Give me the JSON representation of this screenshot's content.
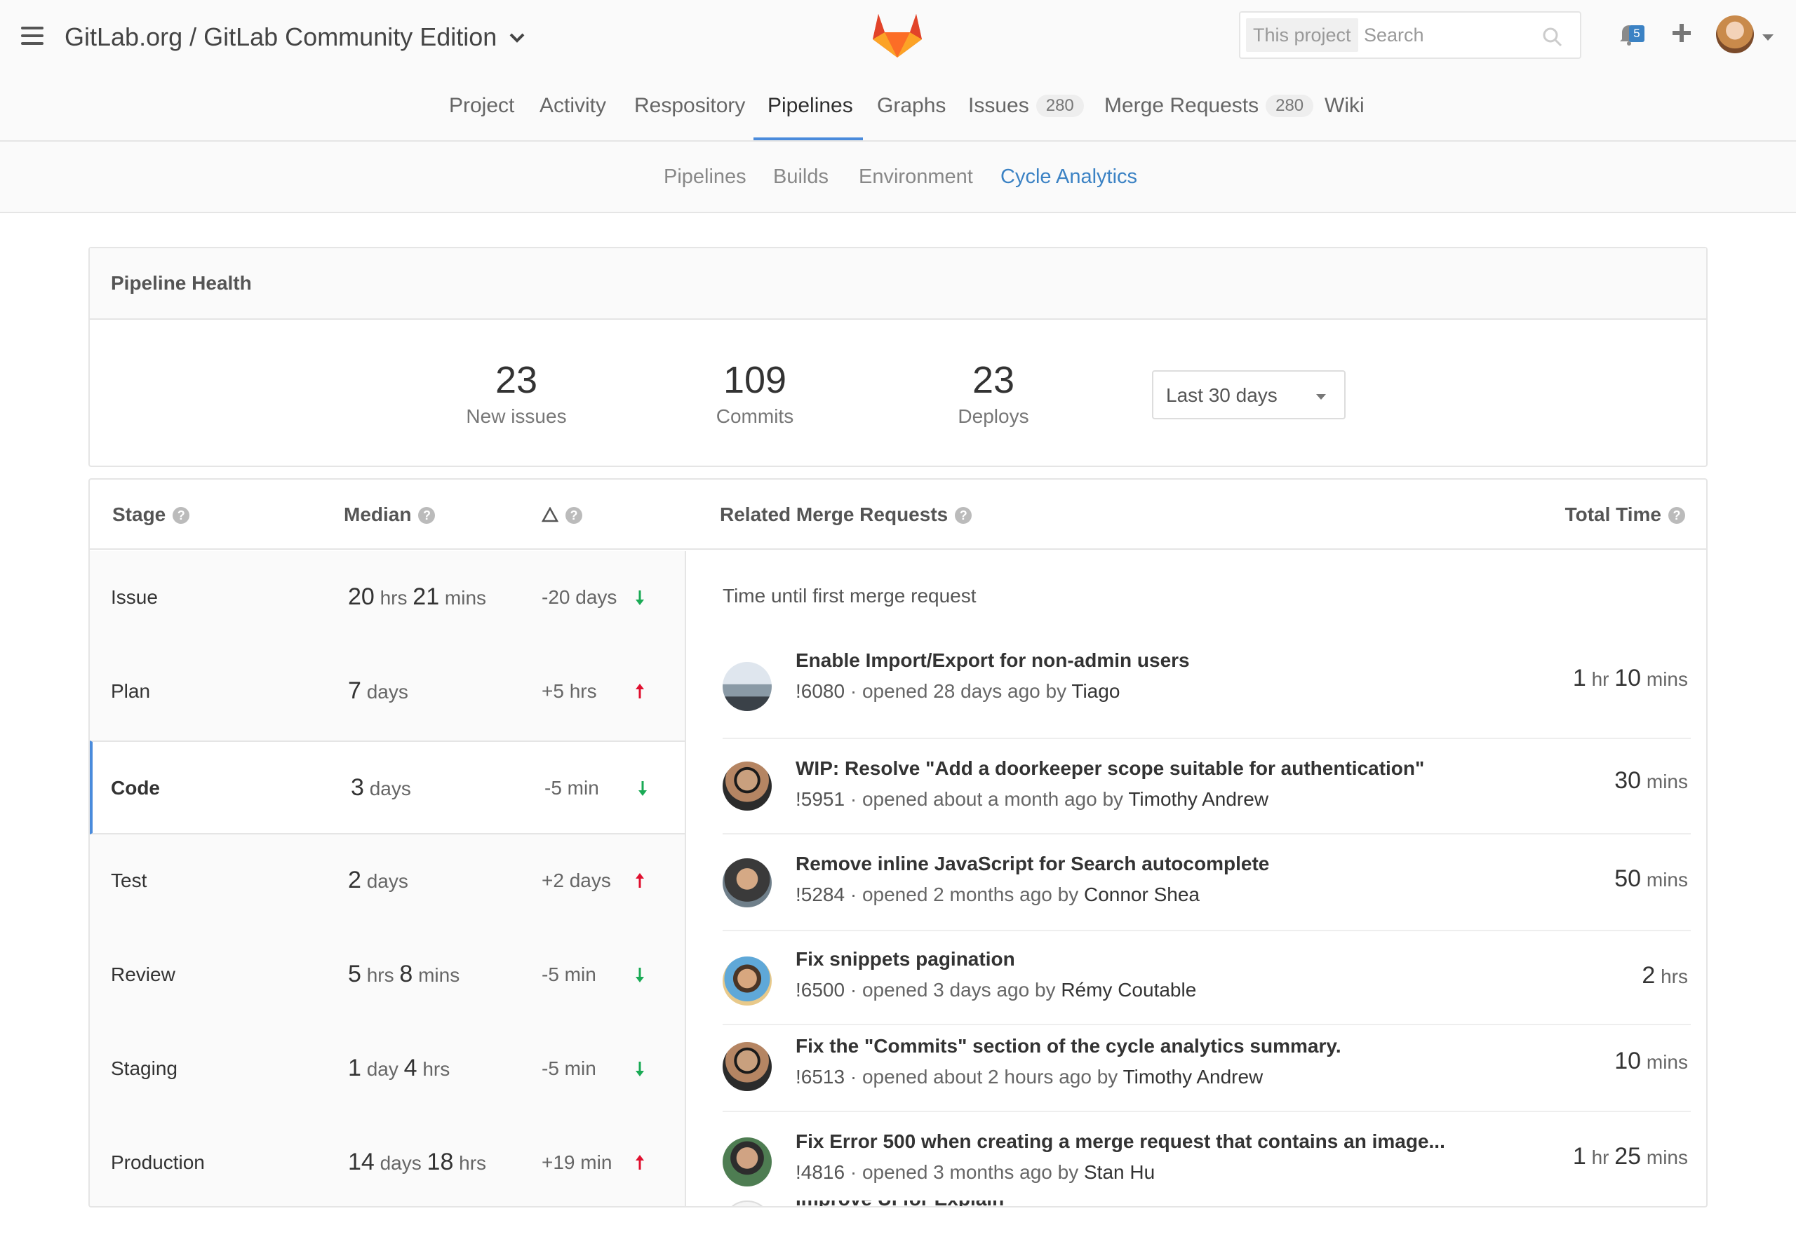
{
  "header": {
    "project_title": "GitLab.org / GitLab Community Edition",
    "search_scope": "This project",
    "search_placeholder": "Search",
    "notification_count": "5"
  },
  "nav": {
    "tabs": [
      {
        "label": "Project"
      },
      {
        "label": "Activity"
      },
      {
        "label": "Respository"
      },
      {
        "label": "Pipelines",
        "active": true
      },
      {
        "label": "Graphs"
      },
      {
        "label": "Issues",
        "badge": "280"
      },
      {
        "label": "Merge Requests",
        "badge": "280"
      },
      {
        "label": "Wiki"
      }
    ]
  },
  "subnav": {
    "tabs": [
      {
        "label": "Pipelines"
      },
      {
        "label": "Builds"
      },
      {
        "label": "Environment"
      },
      {
        "label": "Cycle Analytics",
        "active": true
      }
    ]
  },
  "health": {
    "title": "Pipeline Health",
    "stats": [
      {
        "value": "23",
        "label": "New issues"
      },
      {
        "value": "109",
        "label": "Commits"
      },
      {
        "value": "23",
        "label": "Deploys"
      }
    ],
    "period": "Last 30 days"
  },
  "table": {
    "headers": {
      "stage": "Stage",
      "median": "Median",
      "related": "Related Merge Requests",
      "total": "Total Time"
    },
    "stages": [
      {
        "name": "Issue",
        "median": [
          [
            "20",
            "hrs"
          ],
          [
            "21",
            "mins"
          ]
        ],
        "delta": "-20 days",
        "trend": "down"
      },
      {
        "name": "Plan",
        "median": [
          [
            "7",
            "days"
          ]
        ],
        "delta": "+5 hrs",
        "trend": "up"
      },
      {
        "name": "Code",
        "median": [
          [
            "3",
            "days"
          ]
        ],
        "delta": "-5 min",
        "trend": "down",
        "active": true
      },
      {
        "name": "Test",
        "median": [
          [
            "2",
            "days"
          ]
        ],
        "delta": "+2 days",
        "trend": "up"
      },
      {
        "name": "Review",
        "median": [
          [
            "5",
            "hrs"
          ],
          [
            "8",
            "mins"
          ]
        ],
        "delta": "-5 min",
        "trend": "down"
      },
      {
        "name": "Staging",
        "median": [
          [
            "1",
            "day"
          ],
          [
            "4",
            "hrs"
          ]
        ],
        "delta": "-5 min",
        "trend": "down"
      },
      {
        "name": "Production",
        "median": [
          [
            "14",
            "days"
          ],
          [
            "18",
            "hrs"
          ]
        ],
        "delta": "+19 min",
        "trend": "up"
      }
    ],
    "caption": "Time until first merge request",
    "merge_requests": [
      {
        "title": "Enable Import/Export for non-admin users",
        "id": "!6080",
        "opened": "opened 28 days ago by",
        "author": "Tiago",
        "time": [
          [
            "1",
            "hr"
          ],
          [
            "10",
            "mins"
          ]
        ],
        "avatar": "landscape"
      },
      {
        "title": "WIP: Resolve \"Add a doorkeeper scope suitable for authentication\"",
        "id": "!5951",
        "opened": "opened about a month ago by",
        "author": "Timothy Andrew",
        "time": [
          [
            "30",
            "mins"
          ]
        ],
        "avatar": "sunglasses"
      },
      {
        "title": "Remove inline JavaScript for Search autocomplete",
        "id": "!5284",
        "opened": "opened 2 months ago by",
        "author": "Connor Shea",
        "time": [
          [
            "50",
            "mins"
          ]
        ],
        "avatar": "portrait-dark"
      },
      {
        "title": "Fix snippets pagination",
        "id": "!6500",
        "opened": "opened 3 days ago by",
        "author": "Rémy Coutable",
        "time": [
          [
            "2",
            "hrs"
          ]
        ],
        "avatar": "beach"
      },
      {
        "title": "Fix the \"Commits\" section of the cycle analytics summary.",
        "id": "!6513",
        "opened": "opened about 2 hours ago by",
        "author": "Timothy Andrew",
        "time": [
          [
            "10",
            "mins"
          ]
        ],
        "avatar": "sunglasses"
      },
      {
        "title": "Fix Error 500 when creating a merge request that contains an image...",
        "id": "!4816",
        "opened": "opened 3 months ago by",
        "author": "Stan Hu",
        "time": [
          [
            "1",
            "hr"
          ],
          [
            "25",
            "mins"
          ]
        ],
        "avatar": "portrait-green"
      }
    ],
    "partial_title": "Improve UI for Explain"
  },
  "colors": {
    "accent": "#4a8bdc",
    "trend_up": "#e0102f",
    "trend_down": "#1aaa55"
  }
}
